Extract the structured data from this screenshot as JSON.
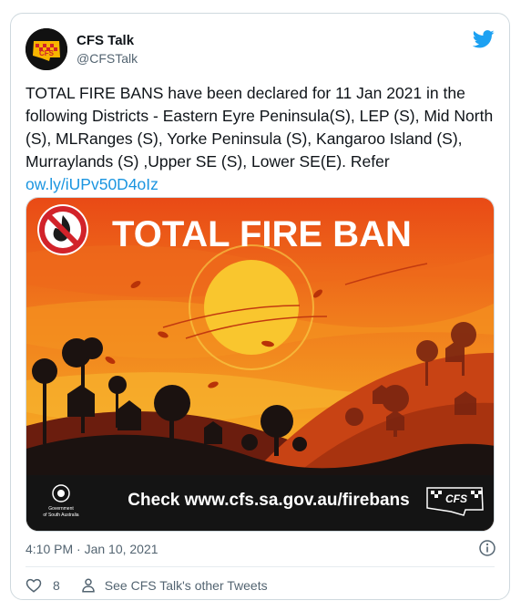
{
  "account": {
    "name": "CFS Talk",
    "handle": "@CFSTalk"
  },
  "tweet": {
    "text": "TOTAL FIRE BANS have been declared for 11 Jan 2021 in the following Districts - Eastern Eyre Peninsula(S), LEP (S), Mid North (S), MLRanges (S), Yorke Peninsula (S), Kangaroo Island (S), Murraylands (S) ,Upper SE (S), Lower SE(E). Refer",
    "link": "ow.ly/iUPv50D4oIz"
  },
  "image": {
    "headline": "TOTAL FIRE BAN",
    "cta": "Check www.cfs.sa.gov.au/firebans",
    "gov_line1": "Government",
    "gov_line2": "of South Australia",
    "brand": "CFS"
  },
  "meta": {
    "timestamp": "4:10 PM · Jan 10, 2021"
  },
  "actions": {
    "likes": "8",
    "see_more": "See CFS Talk's other Tweets"
  },
  "colors": {
    "link": "#1b95e0",
    "twitter_blue": "#1da1f2",
    "text": "#0f1419",
    "muted": "#536471"
  }
}
